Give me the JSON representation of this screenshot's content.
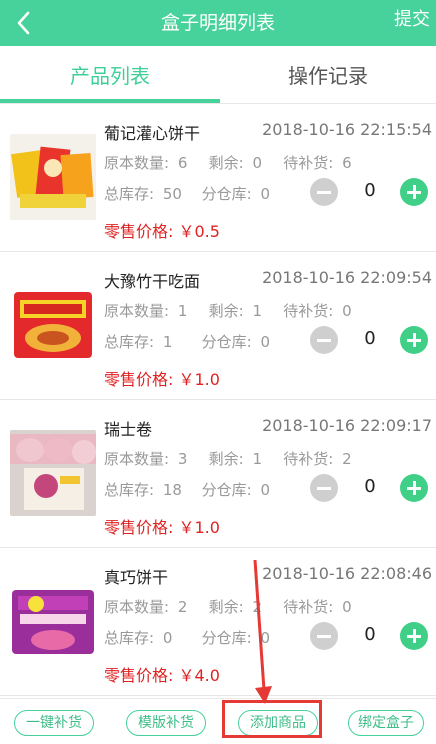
{
  "header": {
    "title": "盒子明细列表",
    "submit_label": "提交"
  },
  "tabs": [
    {
      "label": "产品列表"
    },
    {
      "label": "操作记录"
    }
  ],
  "labels": {
    "original_qty": "原本数量:",
    "remaining": "剩余:",
    "to_restock": "待补货:",
    "total_stock": "总库存:",
    "sub_warehouse": "分仓库:",
    "retail_price": "零售价格:"
  },
  "items": [
    {
      "name": "葡记灌心饼干",
      "time": "2018-10-16 22:15:54",
      "original_qty": "6",
      "remaining": "0",
      "to_restock": "6",
      "total_stock": "50",
      "sub_warehouse": "0",
      "qty": "0",
      "price": "￥0.5"
    },
    {
      "name": "大豫竹干吃面",
      "time": "2018-10-16 22:09:54",
      "original_qty": "1",
      "remaining": "1",
      "to_restock": "0",
      "total_stock": "1",
      "sub_warehouse": "0",
      "qty": "0",
      "price": "￥1.0"
    },
    {
      "name": "瑞士卷",
      "time": "2018-10-16 22:09:17",
      "original_qty": "3",
      "remaining": "1",
      "to_restock": "2",
      "total_stock": "18",
      "sub_warehouse": "0",
      "qty": "0",
      "price": "￥1.0"
    },
    {
      "name": "真巧饼干",
      "time": "2018-10-16 22:08:46",
      "original_qty": "2",
      "remaining": "2",
      "to_restock": "0",
      "total_stock": "0",
      "sub_warehouse": "0",
      "qty": "0",
      "price": "￥4.0"
    }
  ],
  "footer": {
    "btn1": "一键补货",
    "btn2": "模版补货",
    "btn3": "添加商品",
    "btn4": "绑定盒子"
  },
  "colors": {
    "accent": "#47d19b",
    "price": "#e02222",
    "annotation": "#e53935"
  },
  "icons": {
    "back": "chevron-left-icon",
    "minus": "minus-circle-icon",
    "plus": "plus-circle-icon"
  }
}
